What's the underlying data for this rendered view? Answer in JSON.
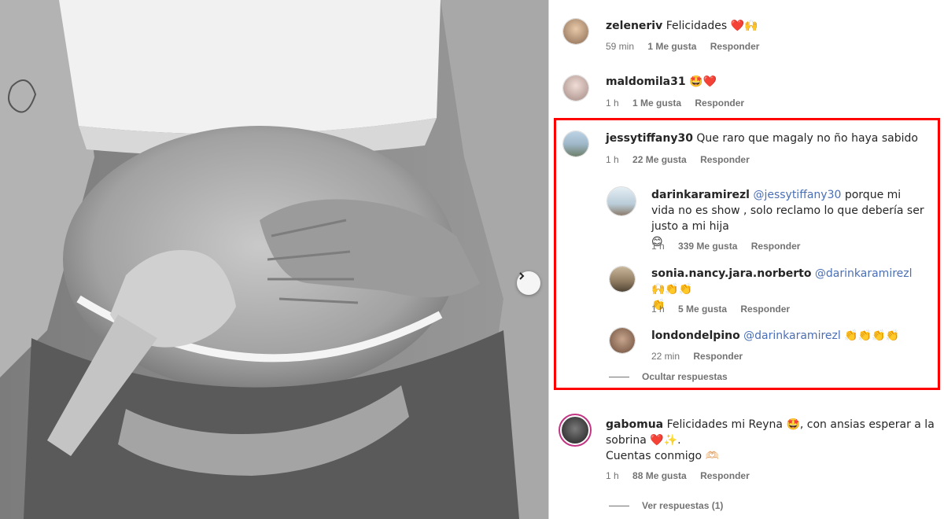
{
  "comments": [
    {
      "username": "zeleneriv",
      "text": "Felicidades",
      "emoji": "❤️🙌",
      "time": "59 min",
      "likes": "1 Me gusta",
      "reply": "Responder"
    },
    {
      "username": "maldomila31",
      "text": "",
      "emoji": "🤩❤️",
      "time": "1 h",
      "likes": "1 Me gusta",
      "reply": "Responder"
    },
    {
      "username": "jessytiffany30",
      "text": "Que raro que magaly no ño haya sabido",
      "time": "1 h",
      "likes": "22 Me gusta",
      "reply": "Responder",
      "replies": [
        {
          "username": "darinkaramirezl",
          "mention": "@jessytiffany30",
          "text_line1": "porque mi vida no es",
          "text_line2": "show , solo reclamo lo que debería ser justo a mi hija",
          "emoji": "😊",
          "time": "1 h",
          "likes": "339 Me gusta",
          "reply": "Responder"
        },
        {
          "username": "sonia.nancy.jara.norberto",
          "mention": "@darinkaramirezl",
          "emoji": "🙌👏👏",
          "emoji2": "👏",
          "time": "1 h",
          "likes": "5 Me gusta",
          "reply": "Responder"
        },
        {
          "username": "londondelpino",
          "mention": "@darinkaramirezl",
          "emoji": "👏👏👏👏",
          "time": "22 min",
          "reply": "Responder"
        }
      ],
      "hide_replies": "Ocultar respuestas"
    },
    {
      "username": "gabomua",
      "text_line1": "Felicidades mi Reyna",
      "emoji_mid": "🤩",
      "text_line1b": ", con ansias esperar a la",
      "text_line2": "sobrina",
      "emoji_line2": "❤️✨.",
      "text_line3": "Cuentas conmigo",
      "text_line3_tail": "🫶🏻",
      "time": "1 h",
      "likes": "88 Me gusta",
      "reply": "Responder",
      "view_replies": "Ver respuestas (1)"
    }
  ],
  "colors": {
    "highlight": "#ff0000",
    "mention": "#4a6fb5",
    "meta": "#737373"
  },
  "icons": {
    "next": "chevron-right-icon"
  }
}
